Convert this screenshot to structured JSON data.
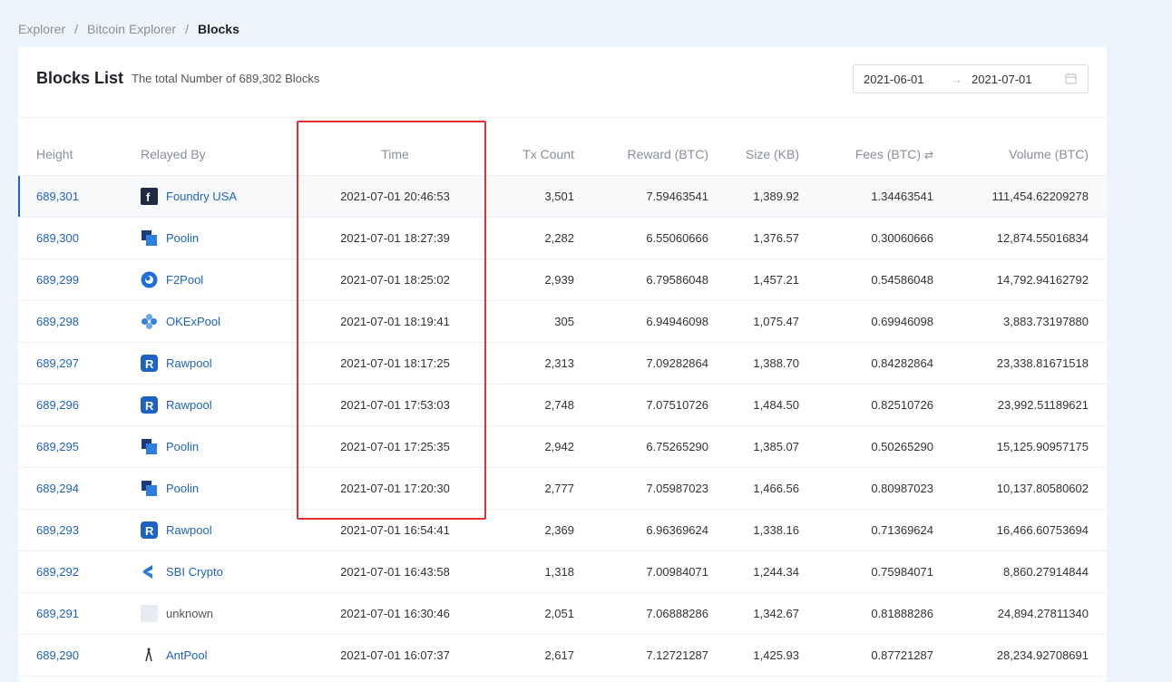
{
  "breadcrumb": [
    "Explorer",
    "Bitcoin Explorer",
    "Blocks"
  ],
  "card": {
    "title": "Blocks List",
    "subtitle": "The total Number of 689,302 Blocks",
    "date_from": "2021-06-01",
    "date_to": "2021-07-01"
  },
  "columns": {
    "height": "Height",
    "relayed_by": "Relayed By",
    "time": "Time",
    "tx_count": "Tx Count",
    "reward": "Reward (BTC)",
    "size": "Size (KB)",
    "fees": "Fees (BTC)",
    "volume": "Volume (BTC)"
  },
  "rows": [
    {
      "height": "689,301",
      "pool": "Foundry USA",
      "logo": "foundry",
      "time": "2021-07-01 20:46:53",
      "tx": "3,501",
      "reward": "7.59463541",
      "size": "1,389.92",
      "fees": "1.34463541",
      "volume": "111,454.62209278"
    },
    {
      "height": "689,300",
      "pool": "Poolin",
      "logo": "poolin",
      "time": "2021-07-01 18:27:39",
      "tx": "2,282",
      "reward": "6.55060666",
      "size": "1,376.57",
      "fees": "0.30060666",
      "volume": "12,874.55016834"
    },
    {
      "height": "689,299",
      "pool": "F2Pool",
      "logo": "f2pool",
      "time": "2021-07-01 18:25:02",
      "tx": "2,939",
      "reward": "6.79586048",
      "size": "1,457.21",
      "fees": "0.54586048",
      "volume": "14,792.94162792"
    },
    {
      "height": "689,298",
      "pool": "OKExPool",
      "logo": "okex",
      "time": "2021-07-01 18:19:41",
      "tx": "305",
      "reward": "6.94946098",
      "size": "1,075.47",
      "fees": "0.69946098",
      "volume": "3,883.73197880"
    },
    {
      "height": "689,297",
      "pool": "Rawpool",
      "logo": "rawpool",
      "time": "2021-07-01 18:17:25",
      "tx": "2,313",
      "reward": "7.09282864",
      "size": "1,388.70",
      "fees": "0.84282864",
      "volume": "23,338.81671518"
    },
    {
      "height": "689,296",
      "pool": "Rawpool",
      "logo": "rawpool",
      "time": "2021-07-01 17:53:03",
      "tx": "2,748",
      "reward": "7.07510726",
      "size": "1,484.50",
      "fees": "0.82510726",
      "volume": "23,992.51189621"
    },
    {
      "height": "689,295",
      "pool": "Poolin",
      "logo": "poolin",
      "time": "2021-07-01 17:25:35",
      "tx": "2,942",
      "reward": "6.75265290",
      "size": "1,385.07",
      "fees": "0.50265290",
      "volume": "15,125.90957175"
    },
    {
      "height": "689,294",
      "pool": "Poolin",
      "logo": "poolin",
      "time": "2021-07-01 17:20:30",
      "tx": "2,777",
      "reward": "7.05987023",
      "size": "1,466.56",
      "fees": "0.80987023",
      "volume": "10,137.80580602"
    },
    {
      "height": "689,293",
      "pool": "Rawpool",
      "logo": "rawpool",
      "time": "2021-07-01 16:54:41",
      "tx": "2,369",
      "reward": "6.96369624",
      "size": "1,338.16",
      "fees": "0.71369624",
      "volume": "16,466.60753694"
    },
    {
      "height": "689,292",
      "pool": "SBI Crypto",
      "logo": "sbi",
      "time": "2021-07-01 16:43:58",
      "tx": "1,318",
      "reward": "7.00984071",
      "size": "1,244.34",
      "fees": "0.75984071",
      "volume": "8,860.27914844"
    },
    {
      "height": "689,291",
      "pool": "unknown",
      "logo": "unknown",
      "time": "2021-07-01 16:30:46",
      "tx": "2,051",
      "reward": "7.06888286",
      "size": "1,342.67",
      "fees": "0.81888286",
      "volume": "24,894.27811340"
    },
    {
      "height": "689,290",
      "pool": "AntPool",
      "logo": "antpool",
      "time": "2021-07-01 16:07:37",
      "tx": "2,617",
      "reward": "7.12721287",
      "size": "1,425.93",
      "fees": "0.87721287",
      "volume": "28,234.92708691"
    }
  ],
  "colors": {
    "link": "#1e63c4",
    "highlight": "#e03232"
  }
}
